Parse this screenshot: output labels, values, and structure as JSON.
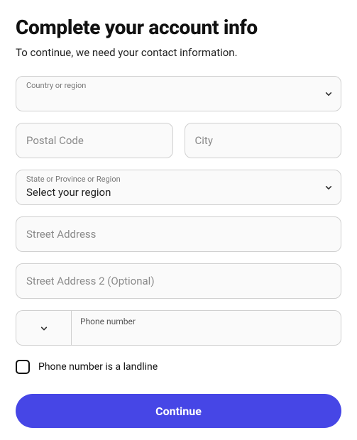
{
  "header": {
    "title": "Complete your account info",
    "subtitle": "To continue, we need your contact information."
  },
  "fields": {
    "country": {
      "label": "Country or region",
      "value": ""
    },
    "postal_code": {
      "placeholder": "Postal Code"
    },
    "city": {
      "placeholder": "City"
    },
    "region": {
      "label": "State or Province or Region",
      "value": "Select your region"
    },
    "street1": {
      "placeholder": "Street Address"
    },
    "street2": {
      "placeholder": "Street Address 2 (Optional)"
    },
    "phone": {
      "label": "Phone number"
    }
  },
  "checkbox": {
    "landline_label": "Phone number is a landline"
  },
  "buttons": {
    "continue": "Continue"
  },
  "colors": {
    "primary": "#4646e6"
  }
}
